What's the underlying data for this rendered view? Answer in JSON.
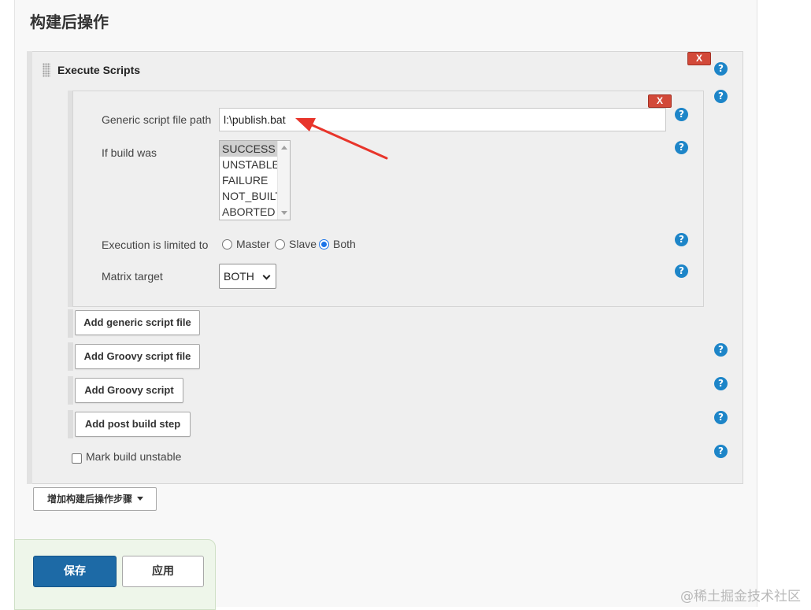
{
  "section": {
    "title": "构建后操作"
  },
  "execute_scripts": {
    "title": "Execute Scripts",
    "delete_label": "X",
    "help_label": "?"
  },
  "generic_script": {
    "delete_label": "X",
    "path_label": "Generic script file path",
    "path_value": "l:\\publish.bat",
    "build_label": "If build was",
    "build_options": [
      "SUCCESS",
      "UNSTABLE",
      "FAILURE",
      "NOT_BUILT",
      "ABORTED"
    ],
    "build_selected": "SUCCESS",
    "execution_label": "Execution is limited to",
    "execution_options": [
      "Master",
      "Slave",
      "Both"
    ],
    "execution_selected": "Both",
    "matrix_label": "Matrix target",
    "matrix_value": "BOTH"
  },
  "buttons": {
    "add_generic": "Add generic script file",
    "add_groovy_file": "Add Groovy script file",
    "add_groovy": "Add Groovy script",
    "add_post_build": "Add post build step"
  },
  "mark_unstable": {
    "label": "Mark build unstable",
    "checked": false
  },
  "add_step": {
    "label": "增加构建后操作步骤"
  },
  "footer": {
    "save": "保存",
    "apply": "应用"
  },
  "watermark": "@稀土掘金技术社区",
  "colors": {
    "help": "#1d85c8",
    "delete": "#d24939",
    "save": "#1d6aa6",
    "arrow": "#e8352b"
  }
}
